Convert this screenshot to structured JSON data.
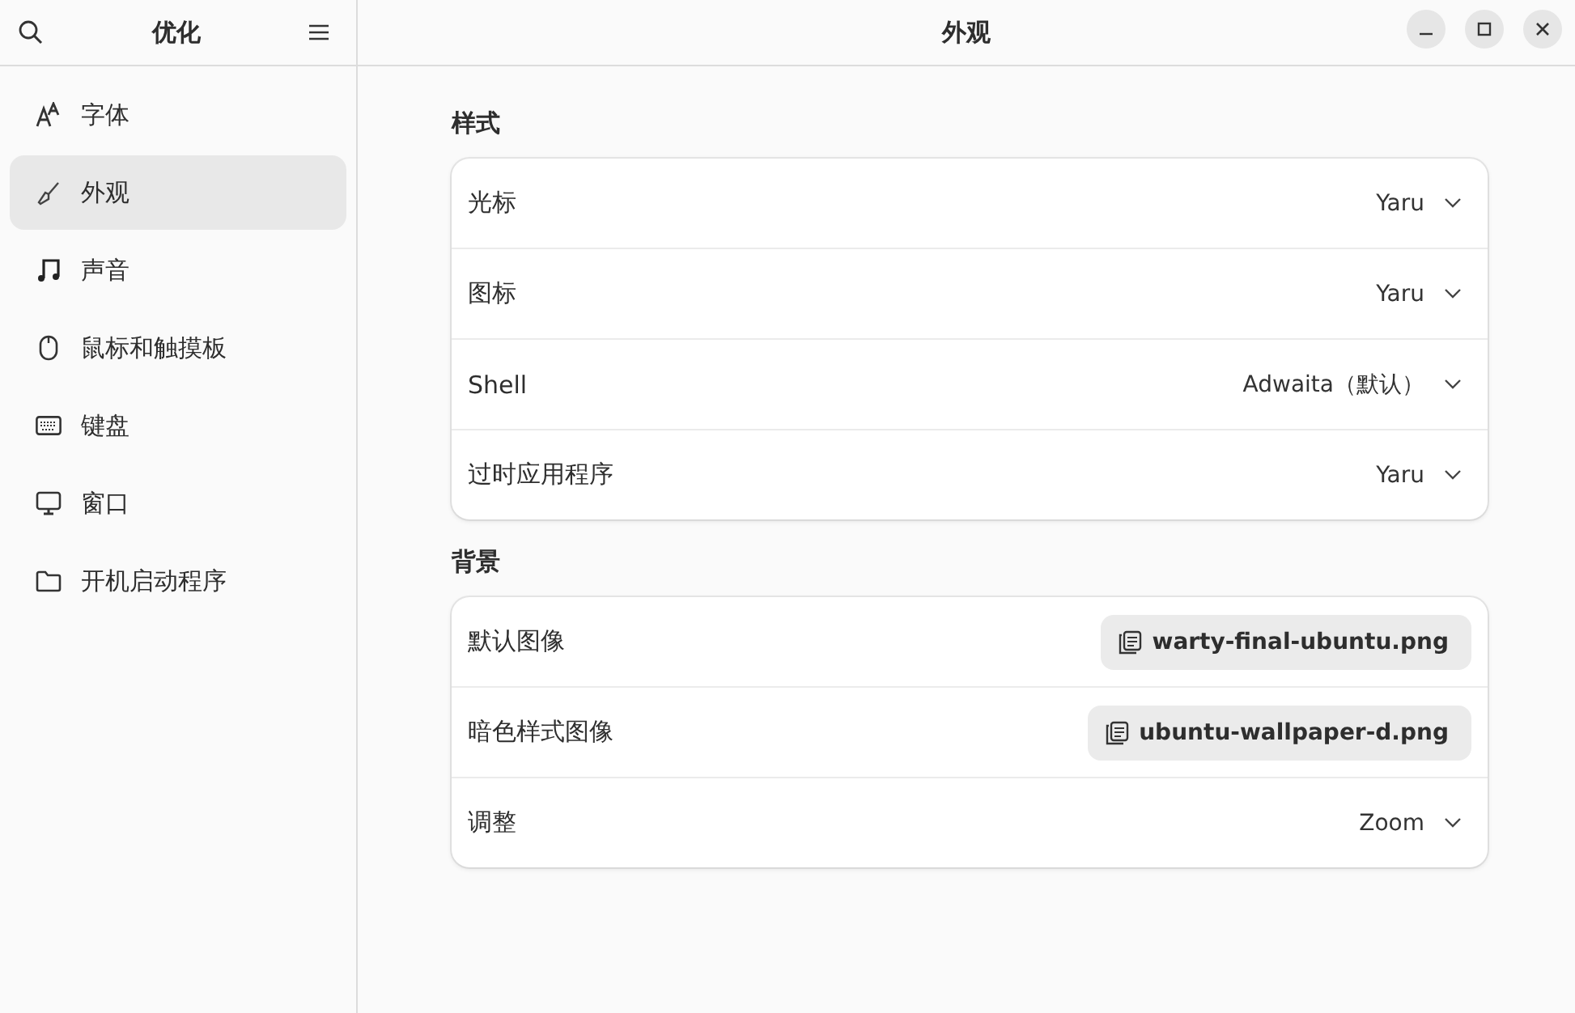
{
  "sidebar": {
    "title": "优化",
    "items": [
      {
        "label": "字体",
        "selected": false
      },
      {
        "label": "外观",
        "selected": true
      },
      {
        "label": "声音",
        "selected": false
      },
      {
        "label": "鼠标和触摸板",
        "selected": false
      },
      {
        "label": "键盘",
        "selected": false
      },
      {
        "label": "窗口",
        "selected": false
      },
      {
        "label": "开机启动程序",
        "selected": false
      }
    ]
  },
  "window": {
    "title": "外观"
  },
  "groups": [
    {
      "title": "样式",
      "rows": [
        {
          "label": "光标",
          "kind": "dropdown",
          "value": "Yaru"
        },
        {
          "label": "图标",
          "kind": "dropdown",
          "value": "Yaru"
        },
        {
          "label": "Shell",
          "kind": "dropdown",
          "value": "Adwaita（默认）"
        },
        {
          "label": "过时应用程序",
          "kind": "dropdown",
          "value": "Yaru"
        }
      ]
    },
    {
      "title": "背景",
      "rows": [
        {
          "label": "默认图像",
          "kind": "file",
          "value": "warty-final-ubuntu.png"
        },
        {
          "label": "暗色样式图像",
          "kind": "file",
          "value": "ubuntu-wallpaper-d.png"
        },
        {
          "label": "调整",
          "kind": "dropdown",
          "value": "Zoom"
        }
      ]
    }
  ]
}
